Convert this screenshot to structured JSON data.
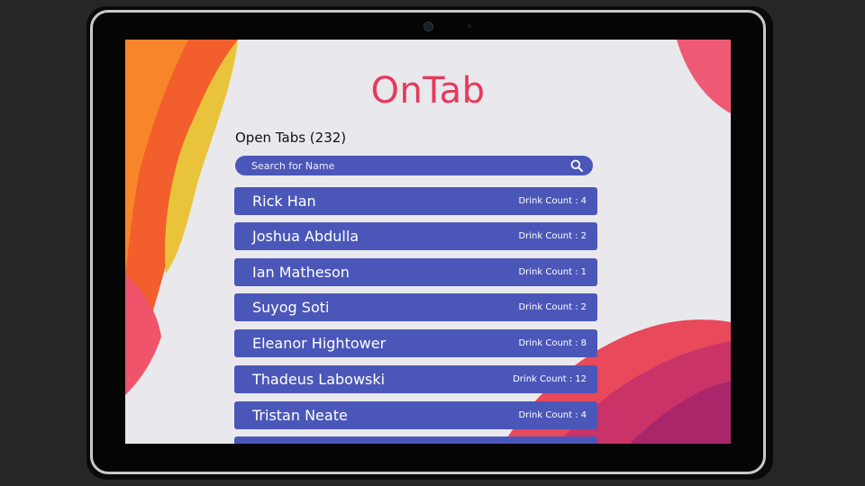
{
  "app": {
    "title": "OnTab"
  },
  "tabs_section": {
    "heading": "Open Tabs (232)"
  },
  "search": {
    "placeholder": "Search for Name",
    "value": "",
    "icon": "search-icon"
  },
  "tabs": [
    {
      "name": "Rick Han",
      "count_label": "Drink Count :",
      "count": "4"
    },
    {
      "name": "Joshua Abdulla",
      "count_label": "Drink Count :",
      "count": "2"
    },
    {
      "name": "Ian Matheson",
      "count_label": "Drink Count :",
      "count": "1"
    },
    {
      "name": "Suyog Soti",
      "count_label": "Drink Count :",
      "count": "2"
    },
    {
      "name": "Eleanor Hightower",
      "count_label": "Drink Count :",
      "count": "8"
    },
    {
      "name": "Thadeus Labowski",
      "count_label": "Drink Count :",
      "count": "12"
    },
    {
      "name": "Tristan Neate",
      "count_label": "Drink Count :",
      "count": "4"
    },
    {
      "name": "",
      "count_label": "",
      "count": ""
    }
  ],
  "colors": {
    "accent": "#4b57b8",
    "title": "#e6395c",
    "screen_background": "#e9e8ec"
  }
}
